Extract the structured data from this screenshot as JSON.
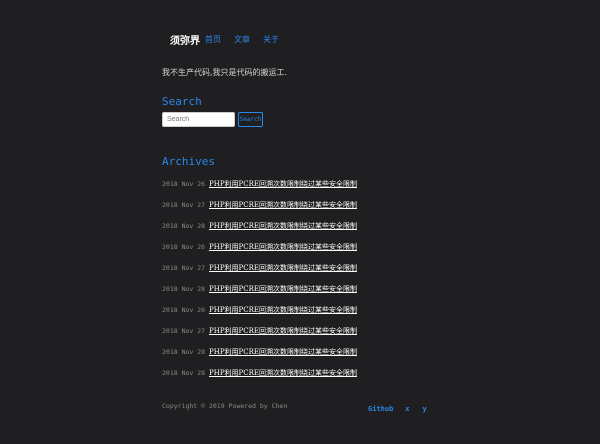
{
  "header": {
    "brand": "须弥界",
    "nav": [
      "首页",
      "文章",
      "关于"
    ]
  },
  "tagline": "我不生产代码,我只是代码的搬运工.",
  "search": {
    "title": "Search",
    "placeholder": "Search",
    "button_label": "Search"
  },
  "archives": {
    "title": "Archives",
    "items": [
      {
        "date": "2018 Nov 26",
        "title": "PHP利用PCRE回溯次数限制绕过某些安全限制"
      },
      {
        "date": "2018 Nov 27",
        "title": "PHP利用PCRE回溯次数限制绕过某些安全限制"
      },
      {
        "date": "2018 Nov 28",
        "title": "PHP利用PCRE回溯次数限制绕过某些安全限制"
      },
      {
        "date": "2018 Nov 26",
        "title": "PHP利用PCRE回溯次数限制绕过某些安全限制"
      },
      {
        "date": "2018 Nov 27",
        "title": "PHP利用PCRE回溯次数限制绕过某些安全限制"
      },
      {
        "date": "2018 Nov 28",
        "title": "PHP利用PCRE回溯次数限制绕过某些安全限制"
      },
      {
        "date": "2018 Nov 26",
        "title": "PHP利用PCRE回溯次数限制绕过某些安全限制"
      },
      {
        "date": "2018 Nov 27",
        "title": "PHP利用PCRE回溯次数限制绕过某些安全限制"
      },
      {
        "date": "2018 Nov 28",
        "title": "PHP利用PCRE回溯次数限制绕过某些安全限制"
      },
      {
        "date": "2018 Nov 28",
        "title": "PHP利用PCRE回溯次数限制绕过某些安全限制"
      }
    ]
  },
  "footer": {
    "copyright": "Copyright © 2019 Powered by Chen",
    "links": [
      "Github",
      "x",
      "y"
    ]
  },
  "colors": {
    "background": "#1f1f21",
    "accent": "#2a86e8",
    "text": "#ffffff",
    "muted": "#8a8a8a"
  }
}
